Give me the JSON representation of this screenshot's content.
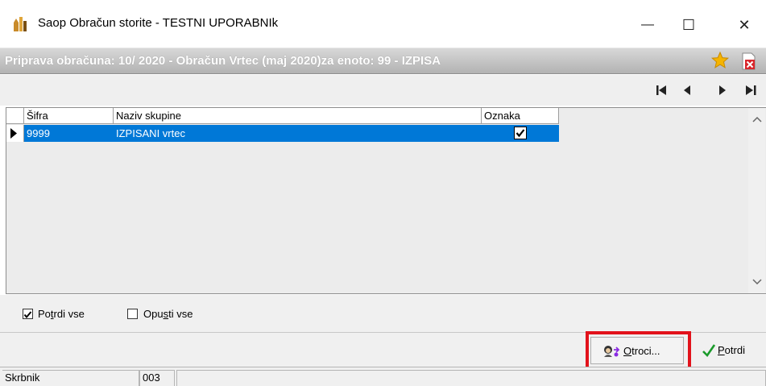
{
  "window": {
    "title": "Saop Obračun storite - TESTNI UPORABNIk",
    "minimize_glyph": "—",
    "maximize_glyph": "☐",
    "close_glyph": "✕"
  },
  "header": {
    "text": "Priprava obračuna: 10/ 2020 - Obračun Vrtec (maj 2020)za enoto: 99 - IZPISA",
    "icons": [
      "star-icon",
      "delete-document-icon"
    ],
    "colors": {
      "star": "#f5b400",
      "delete": "#d9262b"
    }
  },
  "navigation": {
    "buttons": [
      "first-record",
      "previous-record",
      "next-record",
      "last-record"
    ]
  },
  "grid": {
    "columns": [
      "Šifra",
      "Naziv skupine",
      "Oznaka"
    ],
    "rows": [
      {
        "sifra": "9999",
        "naziv": "IZPISANI vrtec",
        "oznaka_checked": true,
        "selected": true
      }
    ],
    "selection_color": "#0078d7"
  },
  "checkboxes": {
    "potrdi_vse": {
      "label_pre": "Po",
      "label_mnemonic": "t",
      "label_post": "rdi vse",
      "checked": true
    },
    "opusti_vse": {
      "label_pre": "Opu",
      "label_mnemonic": "s",
      "label_post": "ti vse",
      "checked": false
    }
  },
  "buttons": {
    "otroci": {
      "label_mnemonic": "O",
      "label_rest": "troci..."
    },
    "potrdi": {
      "label_mnemonic": "P",
      "label_rest": "otrdi"
    }
  },
  "highlight_color": "#e2121b",
  "statusbar": {
    "field1": "Skrbnik",
    "field2": "003",
    "field3": ""
  }
}
